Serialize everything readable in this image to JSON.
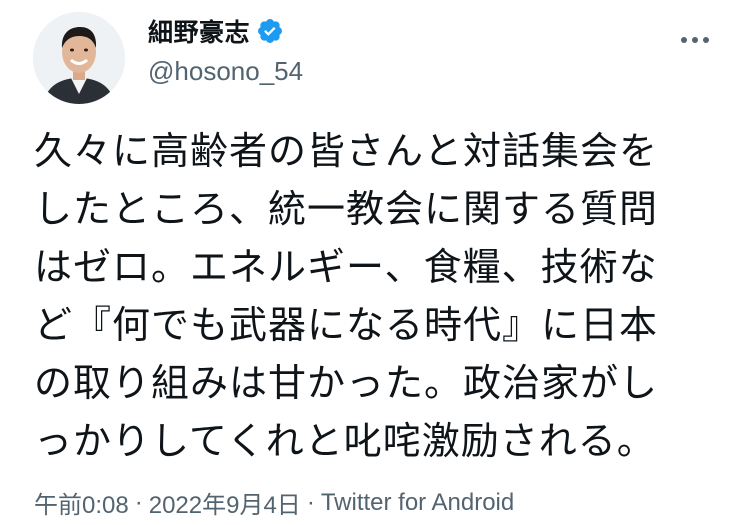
{
  "author": {
    "display_name": "細野豪志",
    "handle": "@hosono_54",
    "verified": true,
    "avatar_icon": "profile-photo-avatar"
  },
  "more_icon": "more-options-icon",
  "tweet": {
    "text": "久々に高齢者の皆さんと対話集会を\nしたところ、統一教会に関する質問\nはゼロ。エネルギー、食糧、技術な\nど『何でも武器になる時代』に日本\nの取り組みは甘かった。政治家がし\nっかりしてくれと叱咤激励される。"
  },
  "meta": {
    "time": "午前0:08",
    "separator": "·",
    "date": "2022年9月4日",
    "source": "Twitter for Android"
  },
  "colors": {
    "verified_blue": "#1d9bf0",
    "secondary_text": "#536471",
    "primary_text": "#0f1419"
  }
}
